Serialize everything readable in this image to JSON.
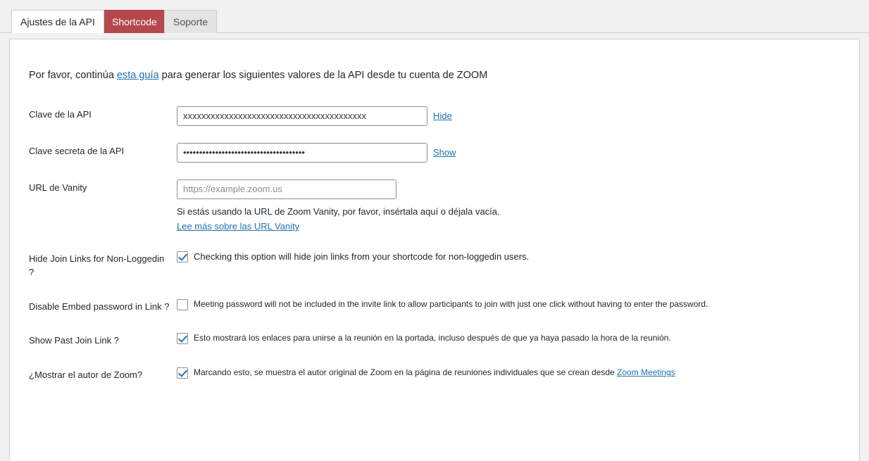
{
  "tabs": [
    {
      "label": "Ajustes de la API",
      "state": "active"
    },
    {
      "label": "Shortcode",
      "state": "danger"
    },
    {
      "label": "Soporte",
      "state": "normal"
    }
  ],
  "intro": {
    "before": "Por favor, continúa ",
    "link": "esta guía",
    "after": " para generar los siguientes valores de la API desde tu cuenta de ZOOM"
  },
  "fields": {
    "api_key": {
      "label": "Clave de la API",
      "value": "xxxxxxxxxxxxxxxxxxxxxxxxxxxxxxxxxxxxxxxx",
      "toggle_label": "Hide"
    },
    "api_secret": {
      "label": "Clave secreta de la API",
      "value": "••••••••••••••••••••••••••••••••••••••",
      "toggle_label": "Show"
    },
    "vanity_url": {
      "label": "URL de Vanity",
      "value": "",
      "placeholder": "https://example.zoom.us",
      "description": "Si estás usando la URL de Zoom Vanity, por favor, insértala aquí o déjala vacía.",
      "description_link": "Lee más sobre las URL Vanity"
    },
    "hide_join_links": {
      "label": "Hide Join Links for Non-Loggedin ?",
      "checked": true,
      "description": "Checking this option will hide join links from your shortcode for non-loggedin users."
    },
    "disable_embed_password": {
      "label": "Disable Embed password in Link ?",
      "checked": false,
      "description": "Meeting password will not be included in the invite link to allow participants to join with just one click without having to enter the password."
    },
    "show_past_join_link": {
      "label": "Show Past Join Link ?",
      "checked": true,
      "description": "Esto mostrará los enlaces para unirse a la reunión en la portada, incluso después de que ya haya pasado la hora de la reunión."
    },
    "show_zoom_author": {
      "label": "¿Mostrar el autor de Zoom?",
      "checked": true,
      "description": "Marcando esto, se muestra el autor original de Zoom en la página de reuniones individuales que se crean desde ",
      "description_link": "Zoom Meetings"
    }
  },
  "colors": {
    "accent_link": "#2271b1",
    "danger_tab": "#b4484c",
    "page_bg": "#f1f1f1"
  }
}
